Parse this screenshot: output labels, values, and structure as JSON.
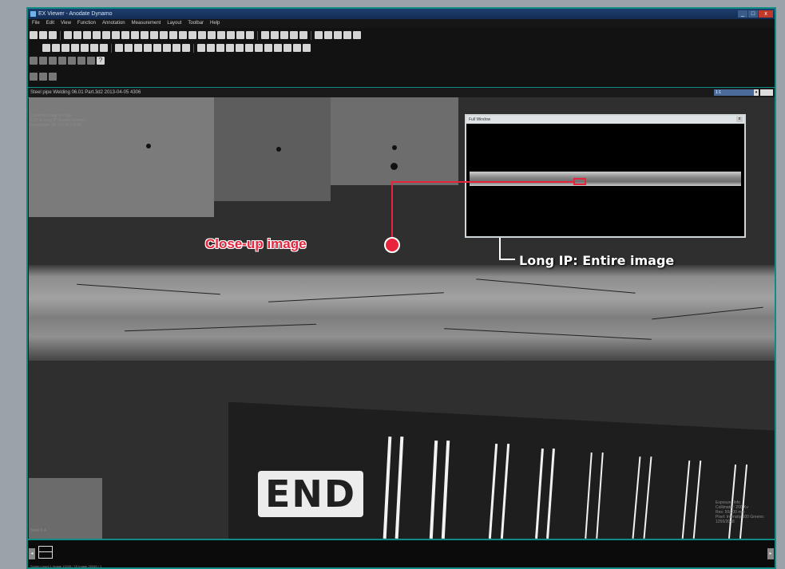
{
  "window": {
    "title": "EX Viewer - Anodate Dynamo",
    "minimize_label": "_",
    "maximize_label": "□",
    "close_label": "x"
  },
  "menu": {
    "items": [
      "File",
      "Edit",
      "View",
      "Function",
      "Annotation",
      "Measurement",
      "Layout",
      "Toolbar",
      "Help"
    ]
  },
  "toolbar": {
    "help_icon_glyph": "?"
  },
  "status_strip": {
    "path_text": "Steel pipe Welding 06.01 Part.3d2 2013-04-05 4306",
    "zoom_value": "1:1",
    "dropdown_glyph": "▾"
  },
  "image_overlay": {
    "top_left_lines": [
      "Cassette Imaging Plate",
      "EXP & Long IP Reader System",
      "Resolution: 25 (50/75/100 M)"
    ],
    "bottom_right_lines": [
      "Exposure Info",
      "Collimator: 200 Kv",
      "Res: 50/100 mm",
      "Pixel: Intensity 100 Greens: 1256/2048"
    ],
    "bottom_left_text": "Steel 0.4",
    "marker_text": "END"
  },
  "full_view": {
    "title": "Full Window",
    "close_label": "x"
  },
  "callouts": {
    "closeup_label": "Close-up image",
    "entire_label": "Long IP:  Entire image"
  },
  "bottom_panel": {
    "left_arrow": "◂",
    "right_arrow": "▸"
  },
  "bottom_status": {
    "text": "Screen count 1 Image 15245 / 15 Image 20045 / 1"
  },
  "colors": {
    "accent_teal": "#0f8c86",
    "callout_red": "#e8243c"
  }
}
